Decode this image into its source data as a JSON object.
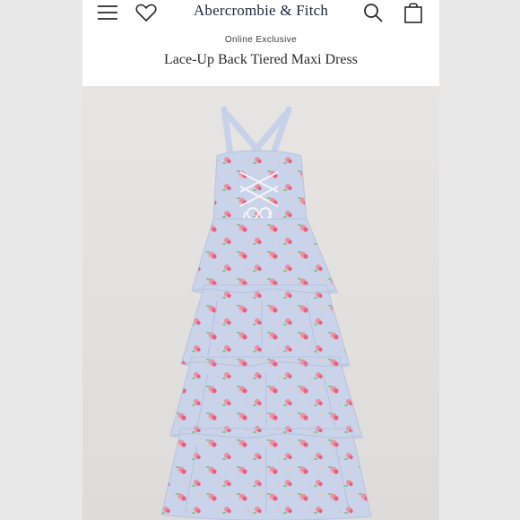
{
  "header": {
    "brand": "Abercrombie & Fitch",
    "icons": {
      "menu": "menu-icon",
      "wishlist": "heart-icon",
      "search": "search-icon",
      "bag": "shopping-bag-icon"
    }
  },
  "product": {
    "badge": "Online Exclusive",
    "title": "Lace-Up Back Tiered Maxi Dress",
    "image": "product-photo"
  },
  "colors": {
    "dress": "#c9d3ea",
    "flower_pink": "#ee8fa4",
    "flower_rose": "#e2637e",
    "leaf": "#8fbf8a",
    "brand_text": "#1b2a3c"
  }
}
